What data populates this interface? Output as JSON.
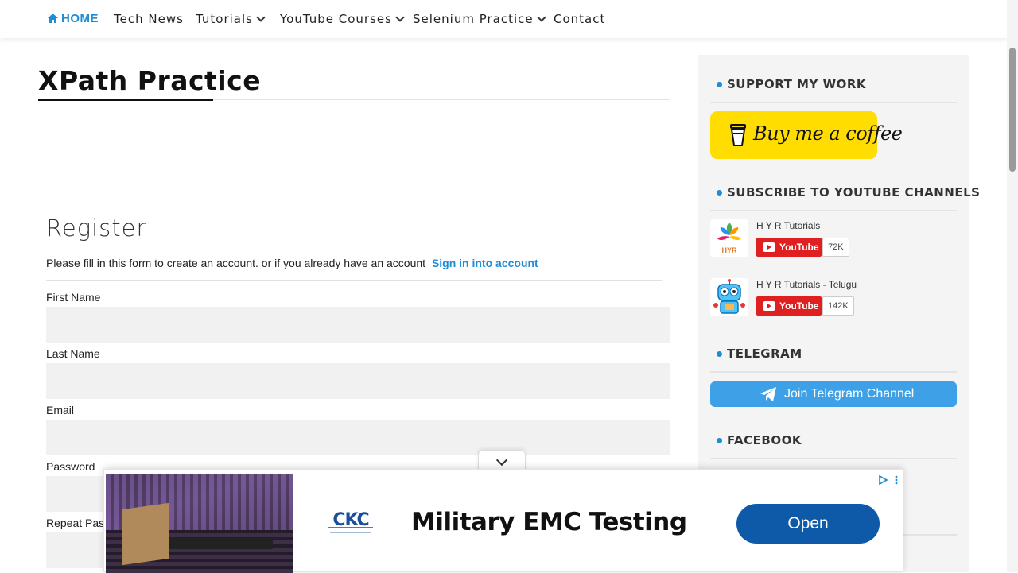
{
  "nav": {
    "home": "HOME",
    "items": [
      "Tech News",
      "Tutorials",
      "YouTube Courses",
      "Selenium Practice",
      "Contact"
    ]
  },
  "main": {
    "title": "XPath Practice",
    "register": {
      "heading": "Register",
      "description": "Please fill in this form to create an account. or if you already have an account",
      "signin_link": "Sign in into account",
      "fields": [
        {
          "label": "First Name",
          "value": ""
        },
        {
          "label": "Last Name",
          "value": ""
        },
        {
          "label": "Email",
          "value": ""
        },
        {
          "label": "Password",
          "value": ""
        },
        {
          "label": "Repeat Pas",
          "value": ""
        }
      ]
    }
  },
  "sidebar": {
    "support_title": "SUPPORT MY WORK",
    "coffee_label": "Buy me a coffee",
    "subscribe_title": "SUBSCRIBE TO YOUTUBE CHANNELS",
    "channels": [
      {
        "name": "H Y R Tutorials",
        "button": "YouTube",
        "count": "72K",
        "logo_text": "HYR"
      },
      {
        "name": "H Y R Tutorials - Telugu",
        "button": "YouTube",
        "count": "142K"
      }
    ],
    "telegram_title": "TELEGRAM",
    "telegram_button": "Join Telegram Channel",
    "facebook_title": "FACEBOOK"
  },
  "ad": {
    "logo_text": "CKC",
    "headline": "Military EMC Testing",
    "cta": "Open"
  },
  "colors": {
    "accent": "#1e8cd6",
    "coffee": "#ffdd00",
    "youtube": "#e02020",
    "telegram": "#3ea0e6",
    "ad_cta": "#0f5aa8"
  }
}
